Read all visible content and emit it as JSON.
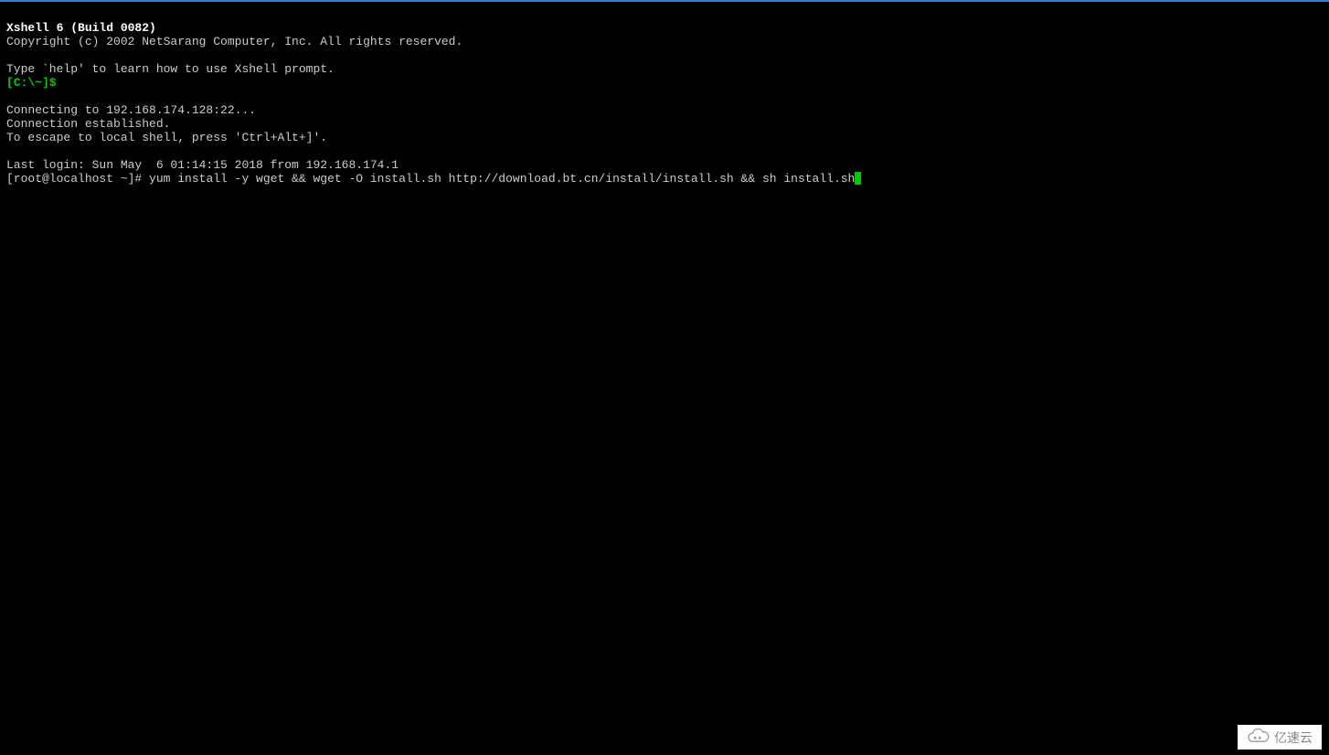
{
  "terminal": {
    "banner_title": "Xshell 6 (Build 0082)",
    "copyright": "Copyright (c) 2002 NetSarang Computer, Inc. All rights reserved.",
    "help_hint": "Type `help' to learn how to use Xshell prompt.",
    "local_prompt": "[C:\\~]$",
    "connecting": "Connecting to 192.168.174.128:22...",
    "established": "Connection established.",
    "escape_hint": "To escape to local shell, press 'Ctrl+Alt+]'.",
    "last_login": "Last login: Sun May  6 01:14:15 2018 from 192.168.174.1",
    "shell_prompt": "[root@localhost ~]# ",
    "command": "yum install -y wget && wget -O install.sh http://download.bt.cn/install/install.sh && sh install.sh"
  },
  "watermark": {
    "text": "亿速云"
  }
}
